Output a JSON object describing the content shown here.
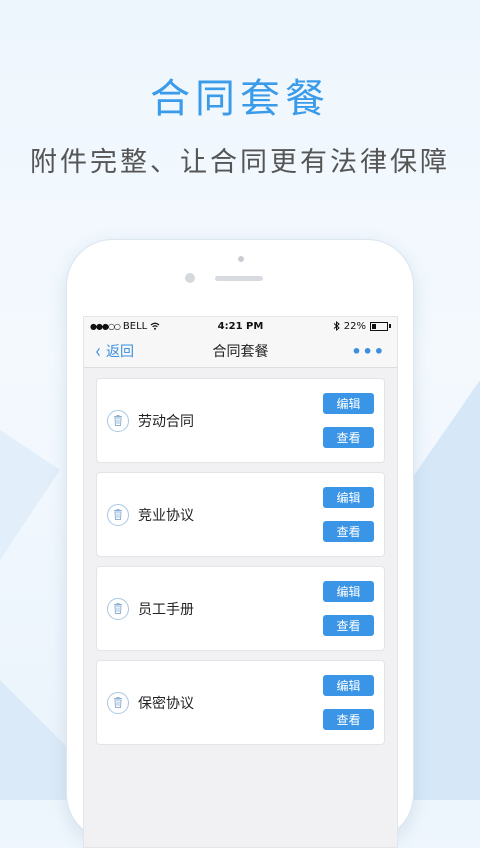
{
  "promo": {
    "title": "合同套餐",
    "subtitle": "附件完整、让合同更有法律保障"
  },
  "statusbar": {
    "signal": "●●●○○",
    "carrier": "BELL",
    "time": "4:21 PM",
    "battery_percent": "22%"
  },
  "navbar": {
    "back_label": "返回",
    "title": "合同套餐",
    "more_label": "•••"
  },
  "items": [
    {
      "label": "劳动合同",
      "edit_label": "编辑",
      "view_label": "查看"
    },
    {
      "label": "竞业协议",
      "edit_label": "编辑",
      "view_label": "查看"
    },
    {
      "label": "员工手册",
      "edit_label": "编辑",
      "view_label": "查看"
    },
    {
      "label": "保密协议",
      "edit_label": "编辑",
      "view_label": "查看"
    }
  ],
  "colors": {
    "accent": "#3a95e6",
    "title_blue": "#3a9bea",
    "bg_light": "#eef6fd",
    "bg_shape": "#d4e6f7"
  }
}
